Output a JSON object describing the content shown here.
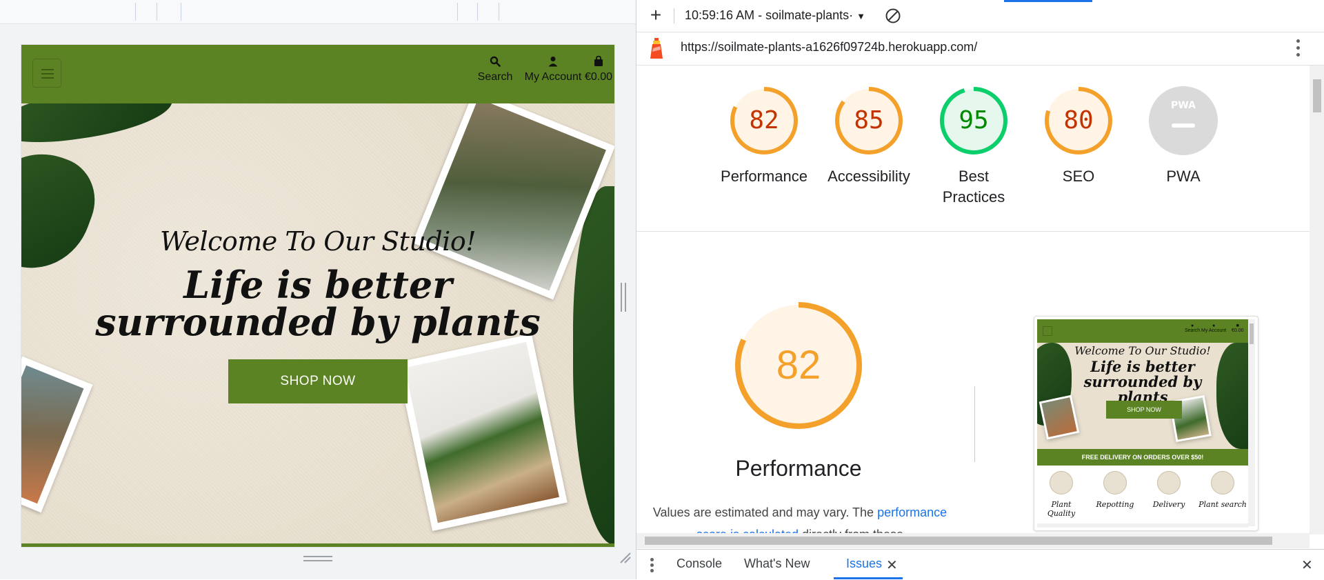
{
  "site": {
    "header": {
      "menu_label": "Menu",
      "search_label": "Search",
      "account_label": "My Account",
      "cart_total": "€0.00"
    },
    "hero": {
      "welcome": "Welcome To Our Studio!",
      "tagline": "Life is better surrounded by plants",
      "cta_label": "SHOP NOW"
    }
  },
  "devtools": {
    "toolbar": {
      "add_label": "+",
      "report_label": "10:59:16 AM - soilmate-plants·"
    },
    "url": "https://soilmate-plants-a1626f09724b.herokuapp.com/",
    "scores": [
      {
        "label": "Performance",
        "value": "82",
        "status": "average"
      },
      {
        "label": "Accessibility",
        "value": "85",
        "status": "average"
      },
      {
        "label": "Best Practices",
        "value": "95",
        "status": "pass"
      },
      {
        "label": "SEO",
        "value": "80",
        "status": "average"
      },
      {
        "label": "PWA",
        "value": "PWA",
        "status": "na"
      }
    ],
    "performance_section": {
      "score": "82",
      "title": "Performance",
      "desc_prefix": "Values are estimated and may vary. The",
      "desc_link": "performance score is calculated",
      "desc_suffix": "directly from these"
    },
    "thumbnail": {
      "search_label": "Search",
      "account_label": "My Account",
      "cart_total": "€0.00",
      "welcome": "Welcome To Our Studio!",
      "tagline": "Life is better surrounded by plants",
      "cta_label": "SHOP NOW",
      "banner": "FREE DELIVERY ON ORDERS OVER $50!",
      "features": [
        "Plant Quality",
        "Repotting",
        "Delivery",
        "Plant search"
      ]
    },
    "drawer_tabs": [
      "Console",
      "What's New",
      "Issues"
    ],
    "colors": {
      "brand_green": "#5b8323",
      "score_average": "#f4a12c",
      "score_average_text": "#c33300",
      "score_pass": "#0cce6b",
      "score_pass_text": "#008800",
      "link": "#1a73e8"
    }
  }
}
